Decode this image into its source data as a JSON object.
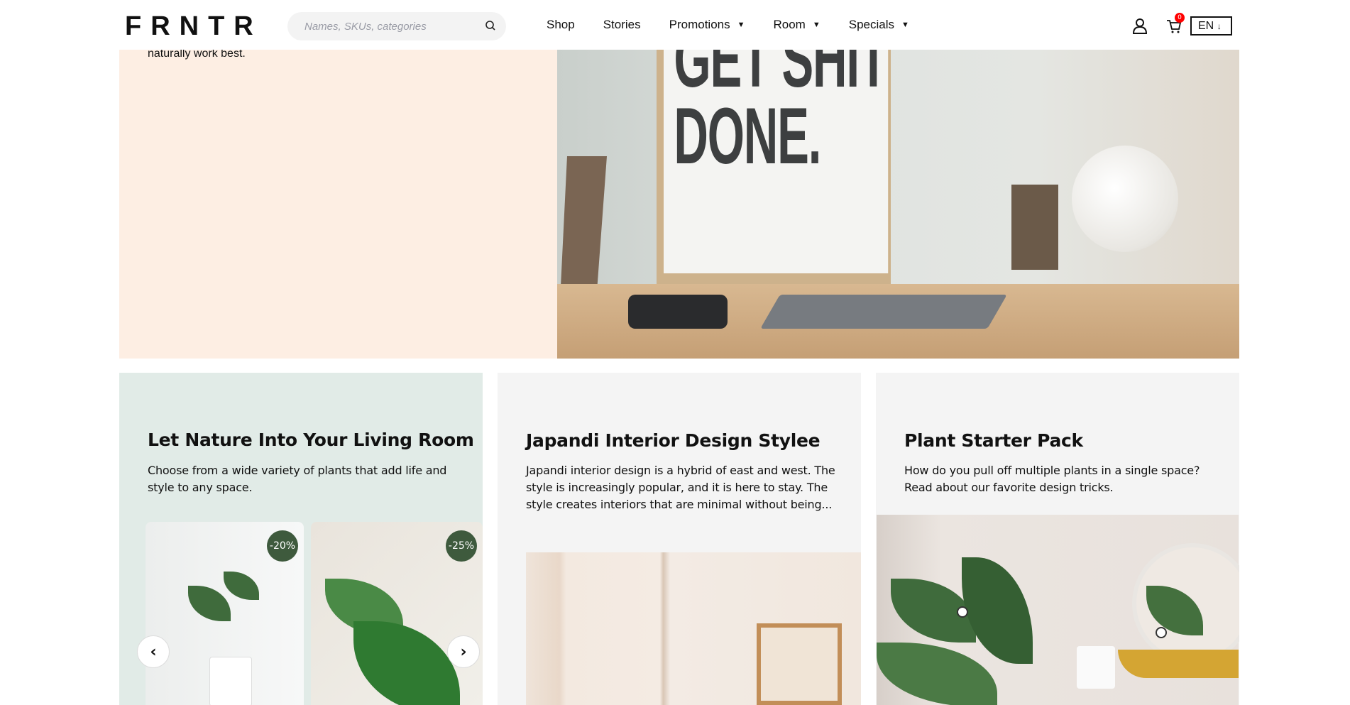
{
  "header": {
    "logo": "FRNTR",
    "search_placeholder": "Names, SKUs, categories",
    "nav": [
      {
        "label": "Shop",
        "dropdown": false
      },
      {
        "label": "Stories",
        "dropdown": false
      },
      {
        "label": "Promotions",
        "dropdown": true
      },
      {
        "label": "Room",
        "dropdown": true
      },
      {
        "label": "Specials",
        "dropdown": true
      }
    ],
    "cart_count": "0",
    "language": "EN"
  },
  "hero": {
    "text": "naturally work best.",
    "poster_text": "GET SHIT DONE."
  },
  "cards": [
    {
      "title": "Let Nature Into Your Living Room",
      "text": "Choose from a wide variety of plants that add life and style to any space.",
      "products": [
        {
          "discount": "-20%"
        },
        {
          "discount": "-25%"
        }
      ]
    },
    {
      "title": "Japandi Interior Design Stylee",
      "text": "Japandi interior design is a hybrid of east and west. The style is increasingly popular, and it is here to stay. The style creates interiors that are minimal without being..."
    },
    {
      "title": "Plant Starter Pack",
      "text": "How do you pull off multiple plants in a single space? Read about our favorite design tricks."
    }
  ],
  "colors": {
    "hero_bg": "#fdeee3",
    "card1_bg": "#e1ebe7",
    "card_bg": "#f4f4f4",
    "discount_badge": "#3e5a3d",
    "cart_badge": "#ff0000"
  }
}
